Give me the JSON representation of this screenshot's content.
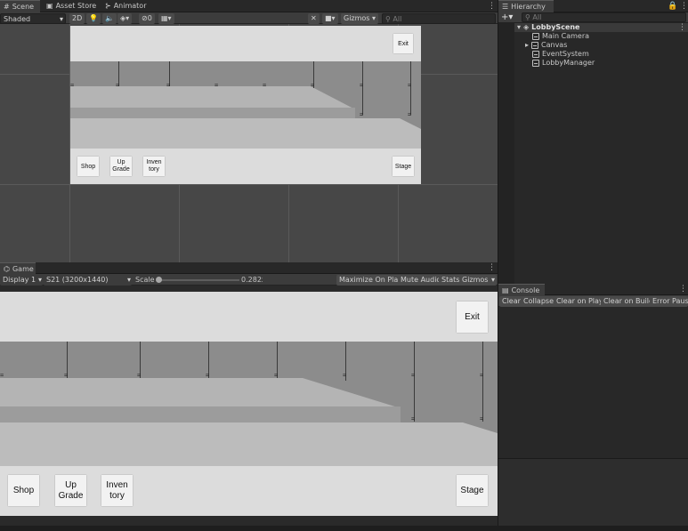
{
  "scene_tabs": {
    "scene": "Scene",
    "asset_store": "Asset Store",
    "animator": "Animator"
  },
  "scene_toolbar": {
    "shading_mode": "Shaded",
    "mode_2d": "2D",
    "hidden_count": "0",
    "gizmos": "Gizmos",
    "search_placeholder": "All"
  },
  "game_tab": {
    "label": "Game"
  },
  "game_toolbar": {
    "display": "Display 1",
    "resolution": "S21 (3200x1440)",
    "scale_label": "Scale",
    "scale_value": "0.282x",
    "scale_fraction": 0.0,
    "maximize_on_play": "Maximize On Play",
    "mute_audio": "Mute Audio",
    "stats": "Stats",
    "gizmos": "Gizmos"
  },
  "game_ui": {
    "exit": "Exit",
    "shop": "Shop",
    "upgrade_line1": "Up",
    "upgrade_line2": "Grade",
    "inventory_line1": "Inven",
    "inventory_line2": "tory",
    "stage": "Stage"
  },
  "hierarchy": {
    "title": "Hierarchy",
    "search_placeholder": "All",
    "scene_name": "LobbyScene",
    "items": [
      "Main Camera",
      "Canvas",
      "EventSystem",
      "LobbyManager"
    ]
  },
  "console": {
    "title": "Console",
    "buttons": [
      "Clear",
      "Collapse",
      "Clear on Play",
      "Clear on Build",
      "Error Pause"
    ]
  },
  "colors": {
    "ui_accent": "#3a72b0",
    "editor_bg": "#282828",
    "panel_bg": "#3c3c3c"
  }
}
